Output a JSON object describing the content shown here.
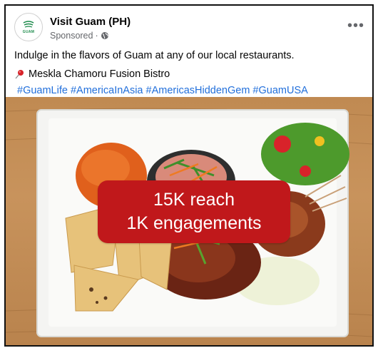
{
  "post": {
    "page_name": "Visit Guam (PH)",
    "avatar_text": "GUAM",
    "sponsored_label": "Sponsored",
    "meta_separator": "·",
    "more_label": "•••",
    "caption": "Indulge in the flavors of Guam at any of our local restaurants.",
    "location": "Meskla Chamoru Fusion Bistro",
    "hashtags": "#GuamLife #AmericaInAsia #AmericasHiddenGem #GuamUSA"
  },
  "overlay": {
    "reach": "15K reach",
    "engagements": "1K engagements"
  },
  "colors": {
    "overlay_bg": "#c0181b",
    "link": "#216fdb",
    "brand_green": "#1b8a4a"
  }
}
